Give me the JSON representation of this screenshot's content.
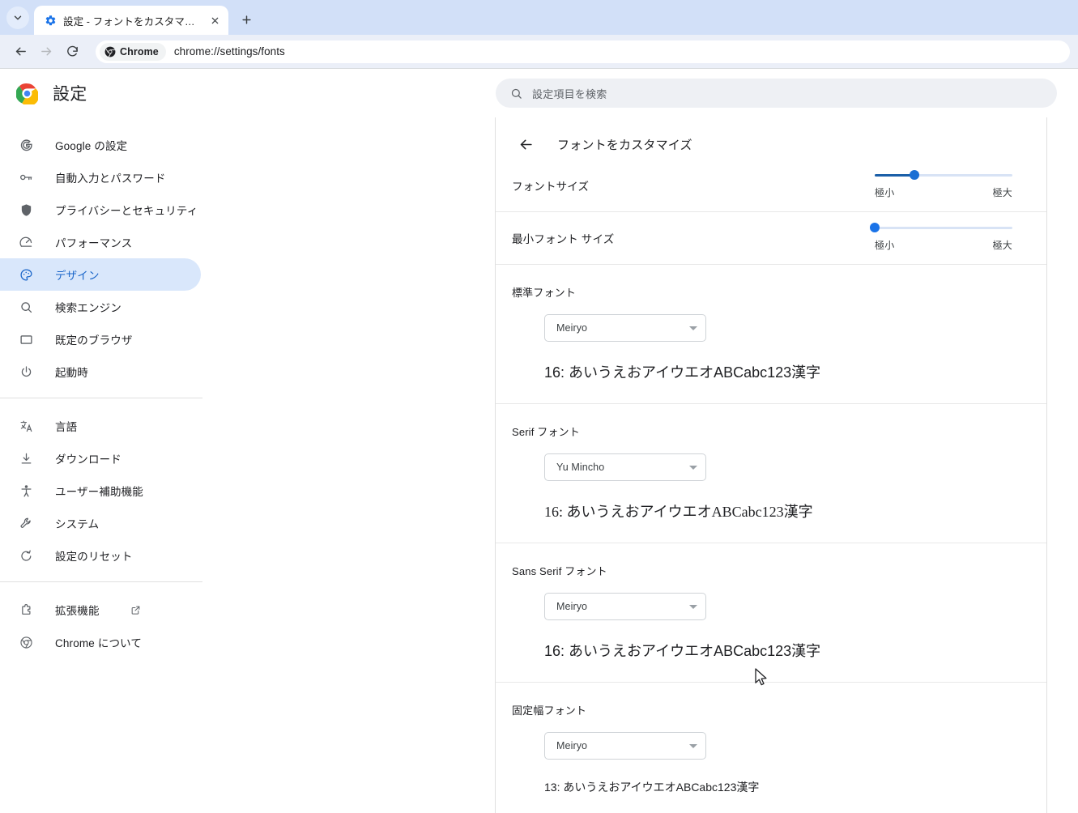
{
  "browser": {
    "tab_search_icon": "chevron-down-icon",
    "tab": {
      "favicon": "settings-gear-icon",
      "title": "設定 - フォントをカスタマイズ",
      "close_icon": "close-icon"
    },
    "new_tab_label": "+",
    "nav": {
      "back_icon": "arrow-left-icon",
      "forward_icon": "arrow-right-icon",
      "reload_icon": "reload-icon"
    },
    "omnibox": {
      "chip_icon": "chrome-logo-icon",
      "chip_label": "Chrome",
      "url": "chrome://settings/fonts"
    }
  },
  "settings": {
    "brand_icon": "chrome-logo-icon",
    "title": "設定",
    "search": {
      "icon": "search-icon",
      "placeholder": "設定項目を検索"
    }
  },
  "sidebar": {
    "groups": [
      {
        "items": [
          {
            "icon": "google-g-icon",
            "label": "Google の設定",
            "selected": false
          },
          {
            "icon": "key-icon",
            "label": "自動入力とパスワード",
            "selected": false
          },
          {
            "icon": "shield-icon",
            "label": "プライバシーとセキュリティ",
            "selected": false
          },
          {
            "icon": "speedometer-icon",
            "label": "パフォーマンス",
            "selected": false
          },
          {
            "icon": "palette-icon",
            "label": "デザイン",
            "selected": true
          },
          {
            "icon": "search-icon",
            "label": "検索エンジン",
            "selected": false
          },
          {
            "icon": "browser-window-icon",
            "label": "既定のブラウザ",
            "selected": false
          },
          {
            "icon": "power-icon",
            "label": "起動時",
            "selected": false
          }
        ]
      },
      {
        "items": [
          {
            "icon": "translate-icon",
            "label": "言語",
            "selected": false
          },
          {
            "icon": "download-icon",
            "label": "ダウンロード",
            "selected": false
          },
          {
            "icon": "accessibility-icon",
            "label": "ユーザー補助機能",
            "selected": false
          },
          {
            "icon": "wrench-icon",
            "label": "システム",
            "selected": false
          },
          {
            "icon": "restore-icon",
            "label": "設定のリセット",
            "selected": false
          }
        ]
      },
      {
        "items": [
          {
            "icon": "extension-icon",
            "label": "拡張機能",
            "selected": false,
            "external": true
          },
          {
            "icon": "chrome-logo-icon",
            "label": "Chrome について",
            "selected": false
          }
        ]
      }
    ]
  },
  "content": {
    "back_icon": "arrow-left-icon",
    "title": "フォントをカスタマイズ",
    "sliders": [
      {
        "label": "フォントサイズ",
        "min_label": "極小",
        "max_label": "極大",
        "value_percent": 29,
        "fill_color": "#1b5fa8",
        "thumb_color": "#1a6fd4"
      },
      {
        "label": "最小フォント サイズ",
        "min_label": "極小",
        "max_label": "極大",
        "value_percent": 0,
        "fill_color": "#1a73e8",
        "thumb_color": "#1a73e8"
      }
    ],
    "font_blocks": [
      {
        "label": "標準フォント",
        "selected_font": "Meiryo",
        "caret_icon": "caret-down-icon",
        "sample": "16: あいうえおアイウエオABCabc123漢字"
      },
      {
        "label": "Serif フォント",
        "selected_font": "Yu Mincho",
        "caret_icon": "caret-down-icon",
        "sample": "16: あいうえおアイウエオABCabc123漢字"
      },
      {
        "label": "Sans Serif フォント",
        "selected_font": "Meiryo",
        "caret_icon": "caret-down-icon",
        "sample": "16: あいうえおアイウエオABCabc123漢字"
      },
      {
        "label": "固定幅フォント",
        "selected_font": "Meiryo",
        "caret_icon": "caret-down-icon",
        "sample": "13: あいうえおアイウエオABCabc123漢字"
      }
    ]
  },
  "colors": {
    "tabstrip": "#d2e0f8",
    "toolbar": "#ebeff8",
    "accent": "#1a73e8",
    "selected_nav_bg": "#d9e7fb",
    "selected_nav_text": "#1b66c9"
  }
}
